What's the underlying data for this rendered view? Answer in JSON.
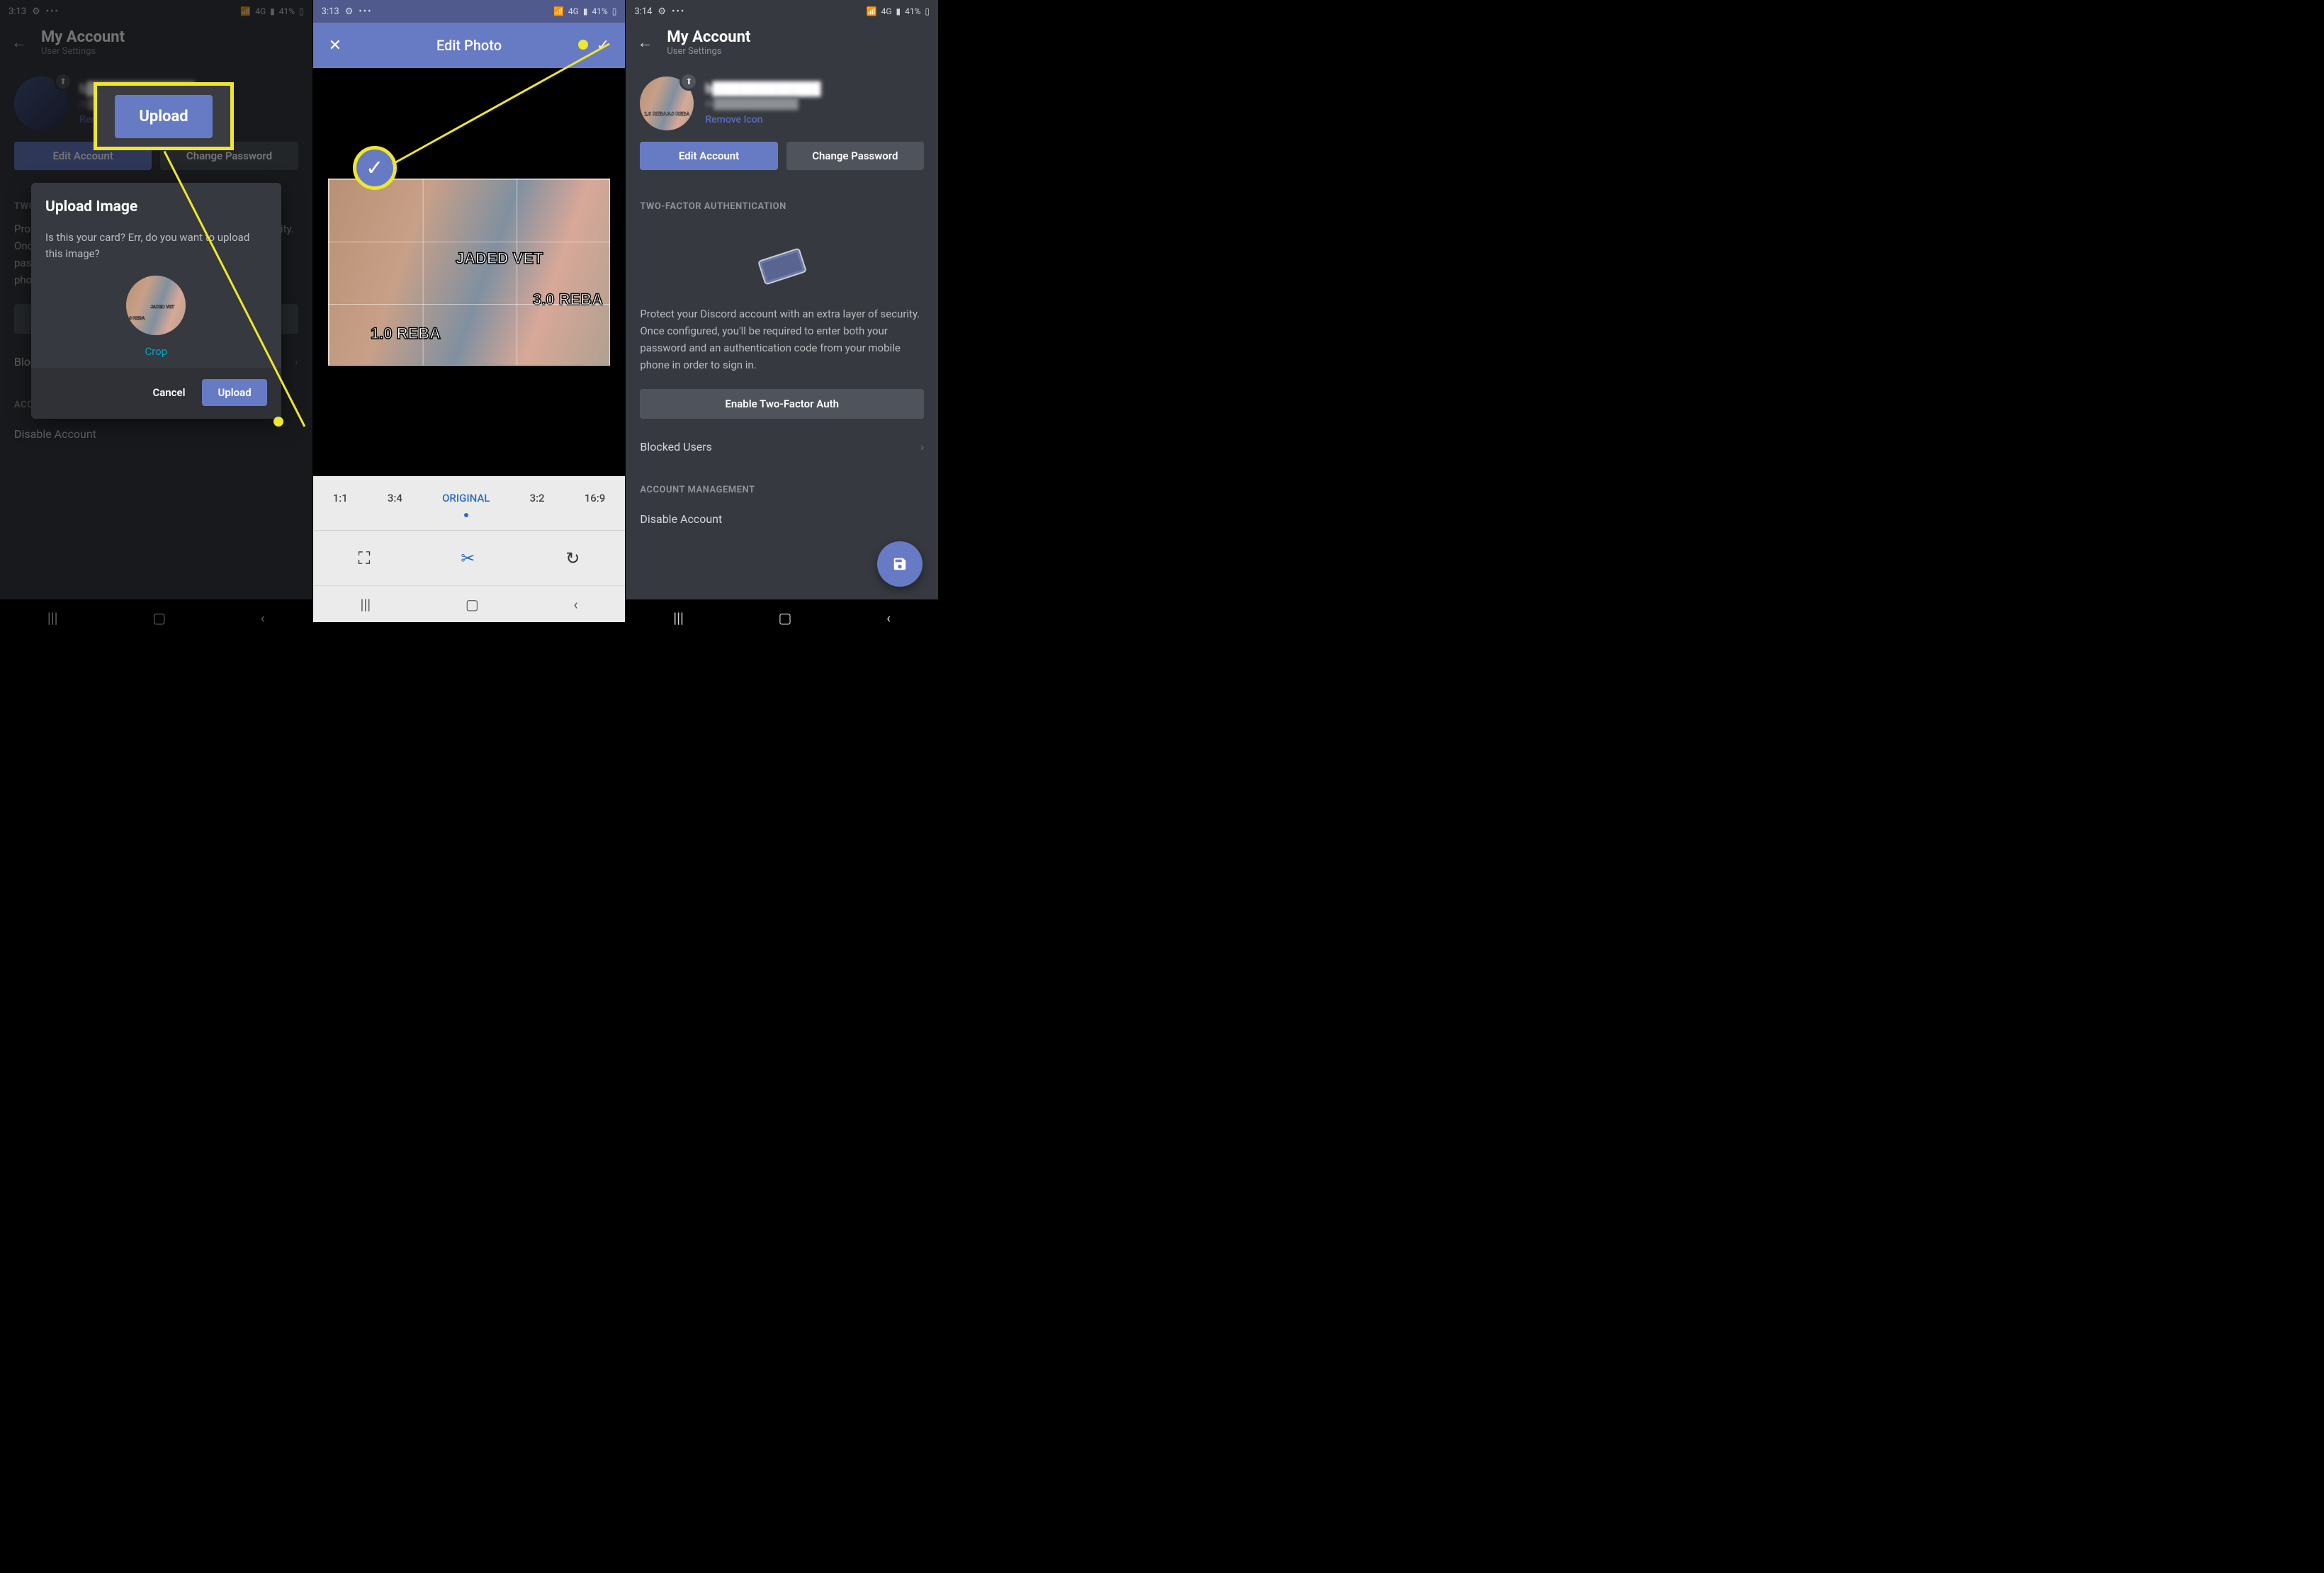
{
  "status": {
    "time1": "3:13",
    "time2": "3:13",
    "time3": "3:14",
    "net": "4G",
    "battery": "41%"
  },
  "header": {
    "title": "My Account",
    "sub": "User Settings"
  },
  "profile": {
    "username": "b████████████",
    "email": "m████████████",
    "remove": "Remove Icon"
  },
  "actions": {
    "edit": "Edit Account",
    "change": "Change Password"
  },
  "tfa": {
    "label": "TWO-FACTOR AUTHENTICATION",
    "info": "Protect your Discord account with an extra layer of security. Once configured, you'll be required to enter both your password and an authentication code from your mobile phone in order to sign in.",
    "enable": "Enable Two-Factor Auth"
  },
  "blocked": "Blocked Users",
  "acctmgmt": "ACCOUNT MANAGEMENT",
  "disable": "Disable Account",
  "callout": {
    "upload": "Upload"
  },
  "modal": {
    "title": "Upload Image",
    "body": "Is this your card? Err, do you want to upload this image?",
    "crop": "Crop",
    "cancel": "Cancel",
    "upload": "Upload"
  },
  "edit": {
    "title": "Edit Photo",
    "ratios": [
      "1:1",
      "3:4",
      "ORIGINAL",
      "3:2",
      "16:9"
    ],
    "active_ratio": "ORIGINAL",
    "meme": {
      "t1": "1.0 REBA",
      "t2": "JADED VET",
      "t3": "3.0 REBA"
    }
  }
}
